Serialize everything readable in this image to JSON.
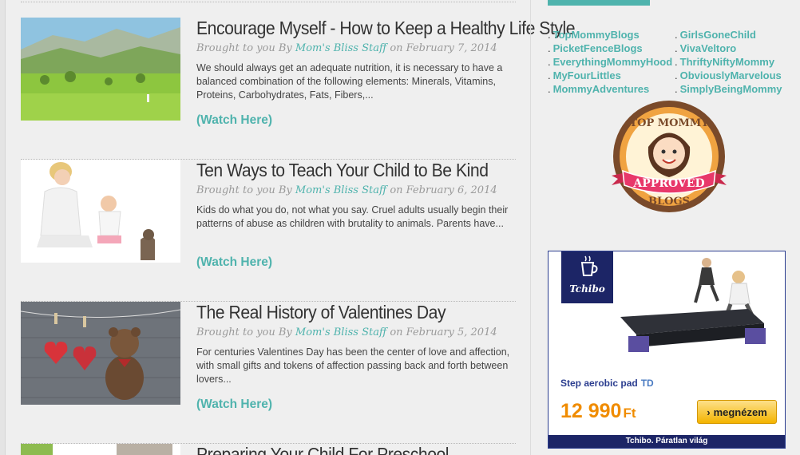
{
  "posts": [
    {
      "title": "Encourage Myself - How to Keep a Healthy Life Style",
      "byline_prefix": "Brought to you By ",
      "author": "Mom's Bliss Staff",
      "date": " on February 7, 2014",
      "excerpt": "We should always get an adequate nutrition, it is necessary to have a balanced combination of the following elements: Minerals, Vitamins, Proteins, Carbohydrates, Fats, Fibers,...",
      "watch_label": "(Watch Here)"
    },
    {
      "title": "Ten Ways to Teach Your Child to Be Kind",
      "byline_prefix": "Brought to you By ",
      "author": "Mom's Bliss Staff",
      "date": " on February 6, 2014",
      "excerpt": "Kids do what you do, not what you say. Cruel adults usually begin their patterns of abuse as children with brutality to animals. Parents have...",
      "watch_label": "(Watch Here)"
    },
    {
      "title": "The Real History of Valentines Day",
      "byline_prefix": "Brought to you By ",
      "author": "Mom's Bliss Staff",
      "date": " on February 5, 2014",
      "excerpt": "For centuries Valentines Day has been the center of love and affection, with small gifts and tokens of affection passing back and forth between lovers...",
      "watch_label": "(Watch Here)"
    },
    {
      "title": "Preparing Your Child For Preschool"
    }
  ],
  "sidebar": {
    "blogs_left": [
      "TopMommyBlogs",
      "PicketFenceBlogs",
      "EverythingMommyHood",
      "MyFourLittles",
      "MommyAdventures"
    ],
    "blogs_right": [
      "GirlsGoneChild",
      "VivaVeltoro",
      "ThriftyNiftyMommy",
      "ObviouslyMarvelous",
      "SimplyBeingMommy"
    ],
    "badge": {
      "top_text": "TOP MOMMY",
      "ribbon_text": "APPROVED",
      "bottom_text": "BLOGS"
    }
  },
  "ad": {
    "brand": "Tchibo",
    "product": "Step aerobic pad",
    "product_tag": "TD",
    "price": "12 990",
    "currency": "Ft",
    "button_label": "megnézem",
    "footer": "Tchibo. Páratlan világ"
  },
  "colors": {
    "accent": "#4fb3ad",
    "ad_navy": "#1c2566",
    "price_orange": "#f08c00"
  }
}
